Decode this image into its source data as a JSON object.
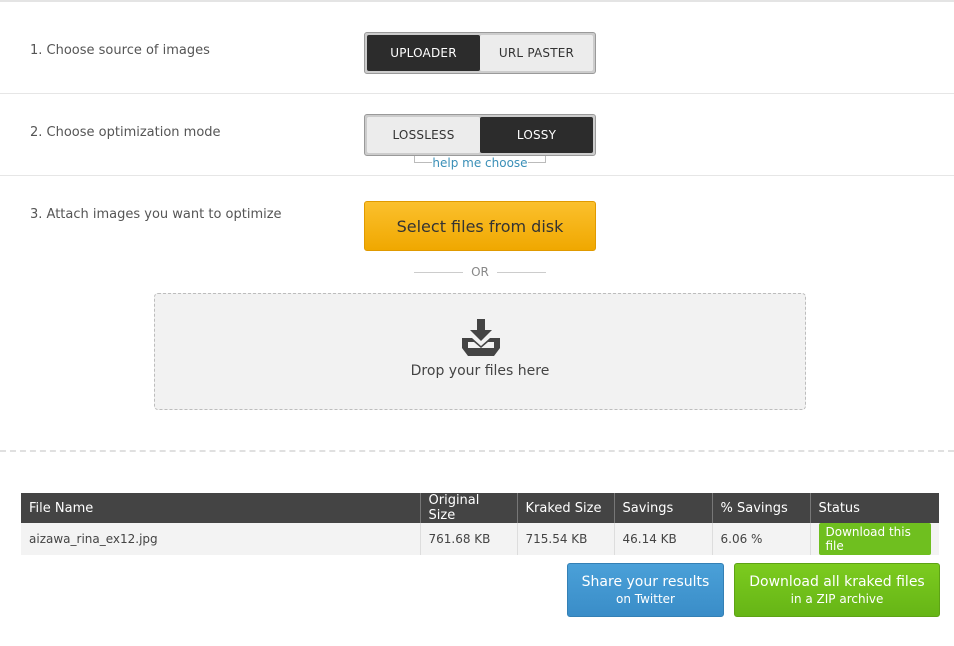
{
  "steps": {
    "source_label": "1. Choose source of images",
    "mode_label": "2. Choose optimization mode",
    "attach_label": "3. Attach images you want to optimize"
  },
  "source_toggle": {
    "uploader": "UPLOADER",
    "url_paster": "URL PASTER",
    "selected": "UPLOADER"
  },
  "mode_toggle": {
    "lossless": "LOSSLESS",
    "lossy": "LOSSY",
    "selected": "LOSSY"
  },
  "help_link": "help me choose",
  "select_files_label": "Select files from disk",
  "or_label": "OR",
  "dropzone": {
    "icon": "download-tray-icon",
    "text": "Drop your files here"
  },
  "table": {
    "headers": [
      "File Name",
      "Original Size",
      "Kraked Size",
      "Savings",
      "% Savings",
      "Status"
    ],
    "rows": [
      {
        "file_name": "aizawa_rina_ex12.jpg",
        "original_size": "761.68 KB",
        "kraked_size": "715.54 KB",
        "savings": "46.14 KB",
        "percent_savings": "6.06 %",
        "status_button": "Download this file"
      }
    ]
  },
  "share_button": {
    "line1": "Share your results",
    "line2": "on Twitter"
  },
  "download_all_button": {
    "line1": "Download all kraked files",
    "line2": "in a ZIP archive"
  },
  "colors": {
    "accent_yellow": "#f5b316",
    "share_blue": "#3f95d0",
    "download_green": "#6fbf1f",
    "active_toggle": "#2c2c2c"
  }
}
